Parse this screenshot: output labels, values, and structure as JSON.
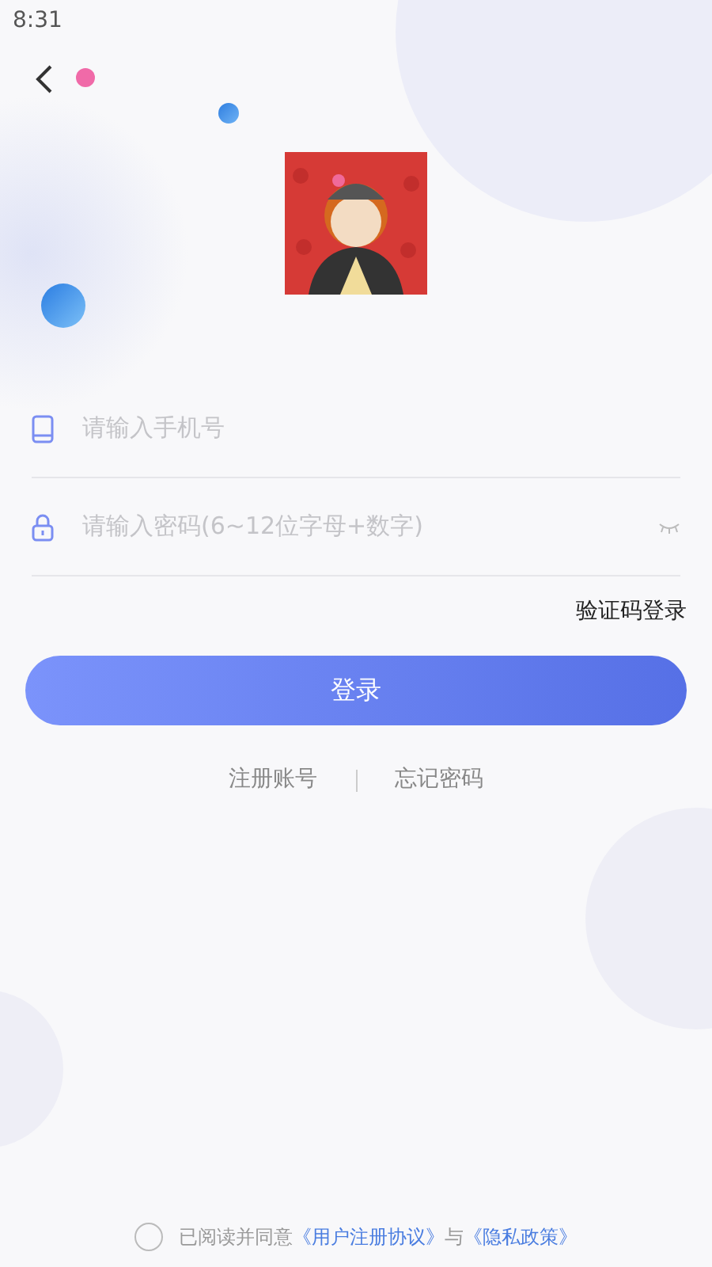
{
  "status_bar": {
    "time": "8:31"
  },
  "phone_field": {
    "placeholder": "请输入手机号"
  },
  "password_field": {
    "placeholder": "请输入密码(6~12位字母+数字)",
    "visible": false
  },
  "code_login_link": "验证码登录",
  "login_button": "登录",
  "links": [
    "注册账号",
    "忘记密码"
  ],
  "agreement": {
    "checked": false,
    "text": "已阅读并同意",
    "links": [
      "《用户注册协议》",
      "《隐私政策》"
    ],
    "conjunction": "与"
  }
}
